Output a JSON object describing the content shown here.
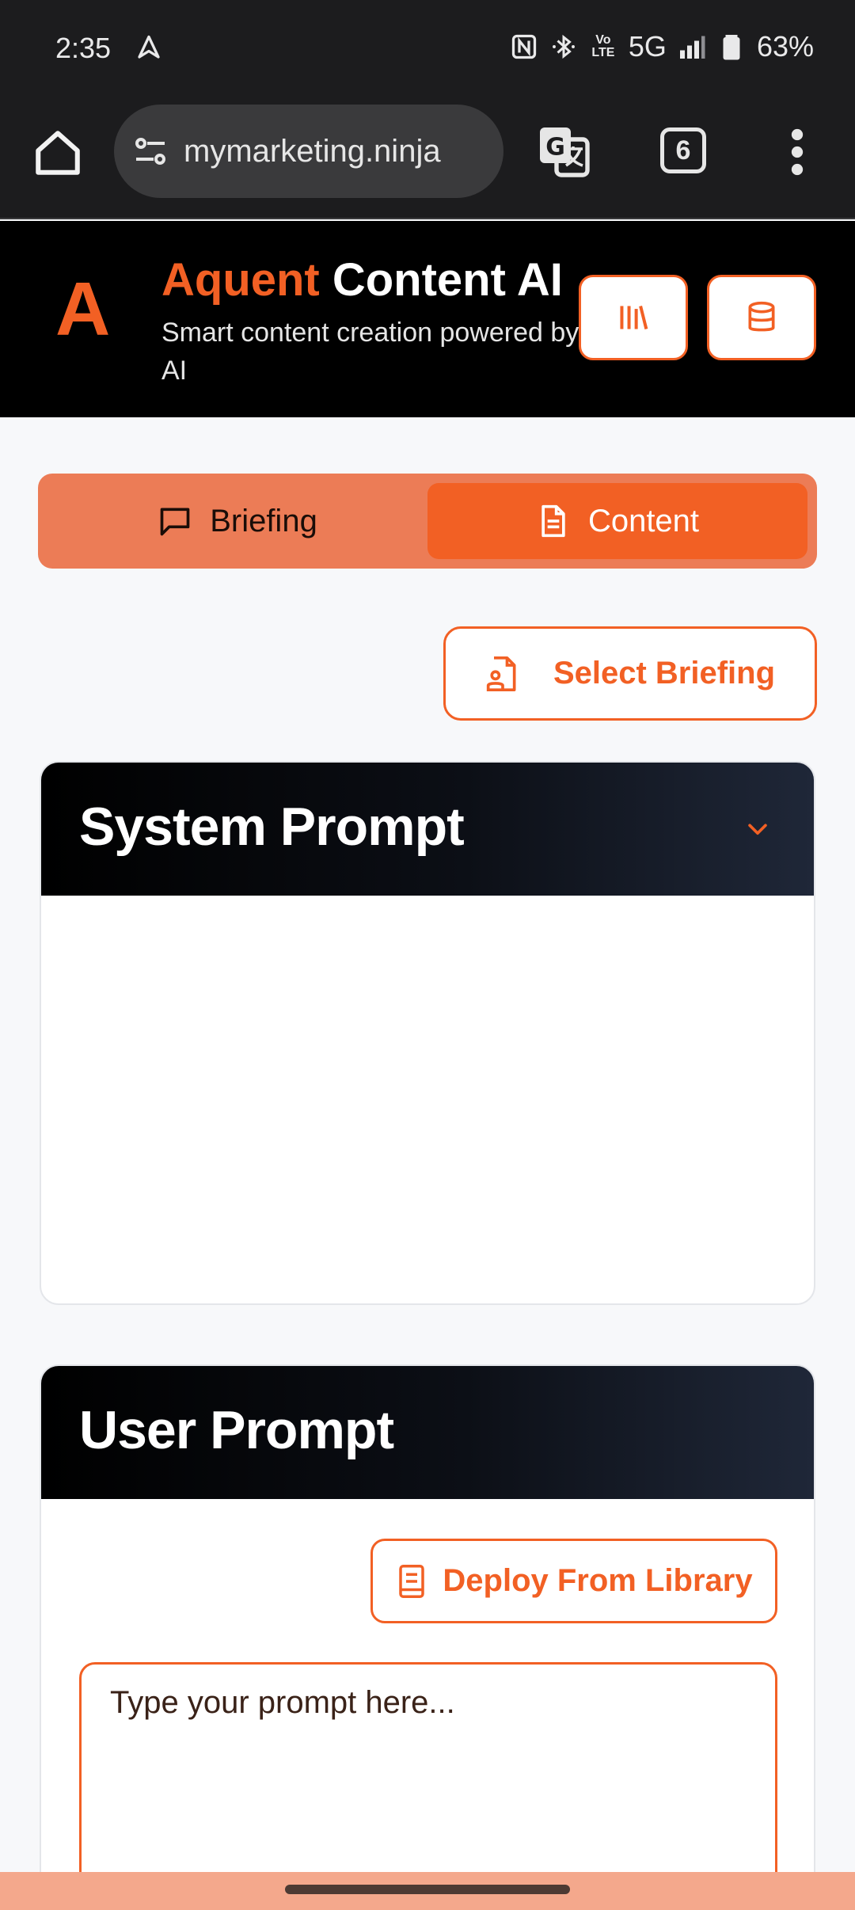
{
  "status_bar": {
    "time": "2:35",
    "network": "5G",
    "volte": "Vo\nLTE",
    "battery": "63%",
    "icons": [
      "navigation-icon",
      "nfc-icon",
      "bluetooth-icon",
      "volte-icon",
      "signal-icon",
      "battery-icon"
    ]
  },
  "browser": {
    "url": "mymarketing.ninja",
    "tab_count": "6"
  },
  "header": {
    "logo_letter": "A",
    "title_accent": "Aquent",
    "title_rest": " Content AI",
    "subtitle": "Smart content creation powered by AI"
  },
  "tabs": {
    "briefing_label": "Briefing",
    "content_label": "Content",
    "active": "Content"
  },
  "select_briefing_label": "Select Briefing",
  "system_prompt": {
    "title": "System Prompt"
  },
  "user_prompt": {
    "title": "User Prompt",
    "deploy_label": "Deploy From Library",
    "placeholder": "Type your prompt here..."
  },
  "colors": {
    "accent": "#f26024",
    "header_bg": "#000000",
    "tab_track": "#ec7c56"
  }
}
